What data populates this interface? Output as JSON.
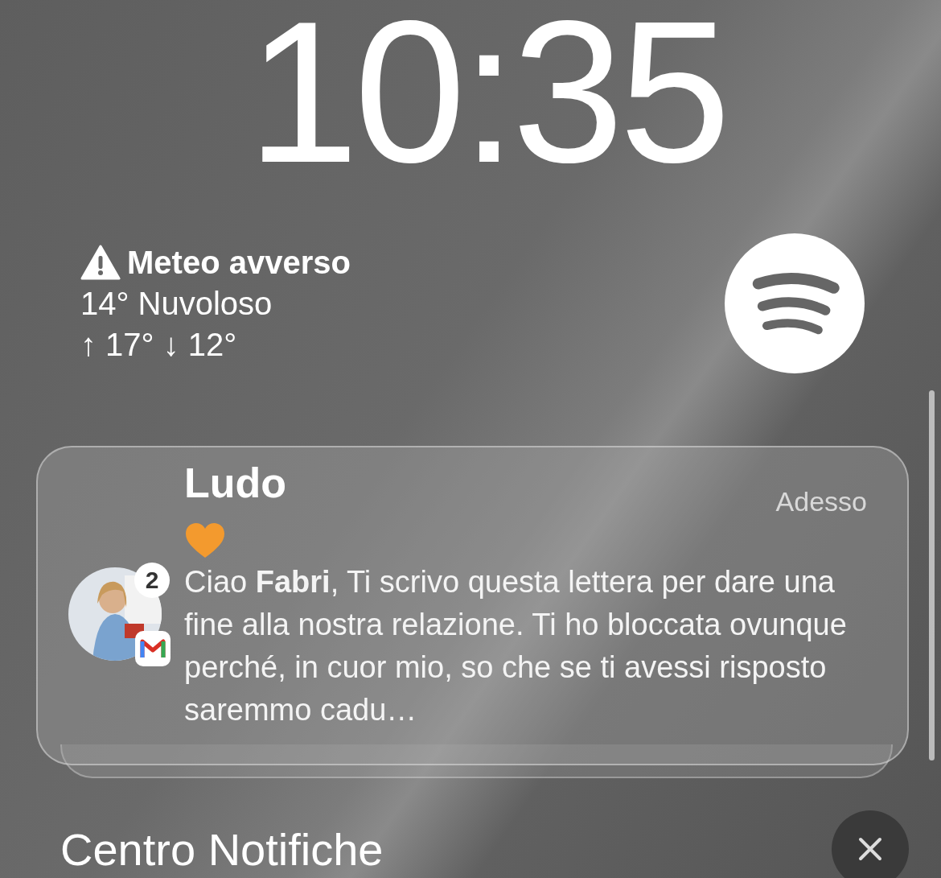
{
  "clock": {
    "time": "10:35"
  },
  "weather": {
    "alert": "Meteo avverso",
    "condition": "14° Nuvoloso",
    "range": "↑ 17° ↓ 12°"
  },
  "notification": {
    "sender": "Ludo",
    "time": "Adesso",
    "badge": "2",
    "body": "Ciao **Fabri**, Ti scrivo questa lettera per dare una fine alla nostra relazione. Ti ho bloccata ovunque perché, in cuor mio, so che se ti avessi risposto saremmo cadu…"
  },
  "notification_center": {
    "title": "Centro Notifiche"
  }
}
